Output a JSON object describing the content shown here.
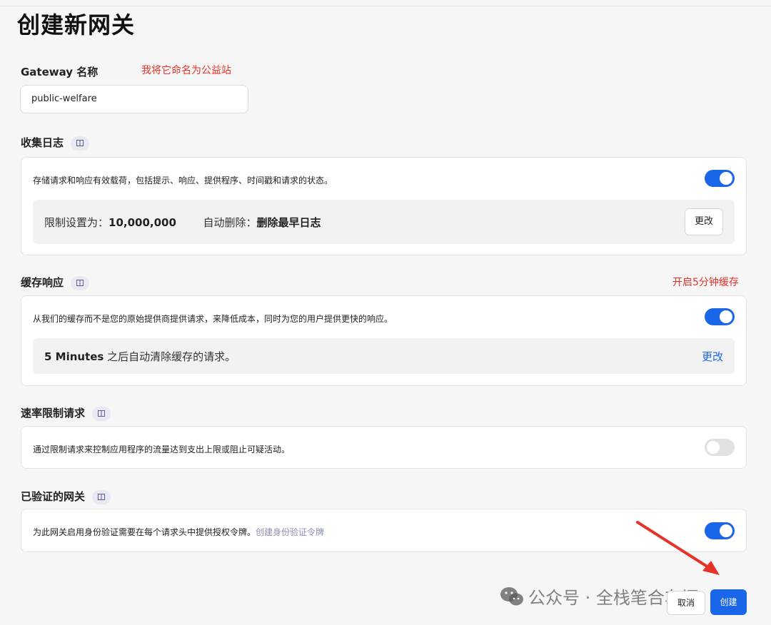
{
  "page": {
    "title": "创建新网关"
  },
  "annotations": {
    "name_note": "我将它命名为公益站",
    "cache_note": "开启5分钟缓存"
  },
  "gateway_name": {
    "label": "Gateway 名称",
    "value": "public-welfare"
  },
  "logs": {
    "title": "收集日志",
    "description": "存储请求和响应有效载荷，包括提示、响应、提供程序、时间戳和请求的状态。",
    "enabled": true,
    "limit_label": "限制设置为：",
    "limit_value": "10,000,000",
    "auto_delete_label": "自动删除：",
    "auto_delete_value": "删除最早日志",
    "change_label": "更改"
  },
  "cache": {
    "title": "缓存响应",
    "description": "从我们的缓存而不是您的原始提供商提供请求，来降低成本，同时为您的用户提供更快的响应。",
    "enabled": true,
    "duration": "5 Minutes",
    "duration_suffix": " 之后自动清除缓存的请求。",
    "change_label": "更改"
  },
  "rate_limit": {
    "title": "速率限制请求",
    "description": "通过限制请求来控制应用程序的流量达到支出上限或阻止可疑活动。",
    "enabled": false
  },
  "auth": {
    "title": "已验证的网关",
    "description": "为此网关启用身份验证需要在每个请求头中提供授权令牌。",
    "token_link": "创建身份验证令牌",
    "enabled": true
  },
  "footer": {
    "cancel_label": "取消",
    "create_label": "创建"
  },
  "watermark": {
    "text": "公众号 · 全栈笔合车间"
  },
  "colors": {
    "accent": "#1a66e8",
    "annotation_red": "#e5332a",
    "toggle_off": "#e1e1e1"
  },
  "icons": {
    "doc": "doc-icon",
    "wechat": "wechat-icon",
    "arrow": "red-arrow-annotation"
  }
}
